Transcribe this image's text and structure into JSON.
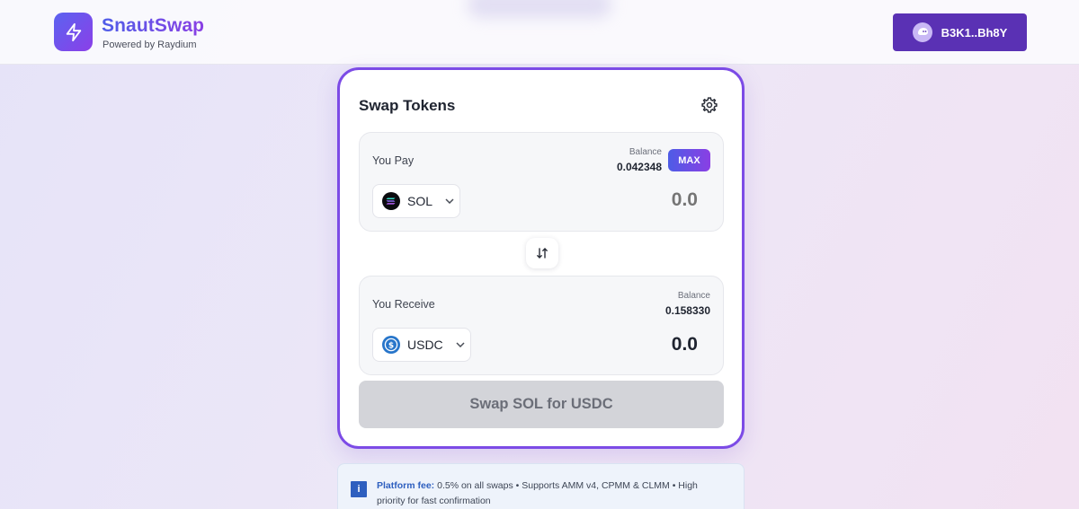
{
  "header": {
    "brand_title": "SnautSwap",
    "brand_subtitle": "Powered by Raydium",
    "wallet_label": "B3K1..Bh8Y"
  },
  "swap": {
    "title": "Swap Tokens",
    "pay": {
      "label": "You Pay",
      "balance_label": "Balance",
      "balance_value": "0.042348",
      "max_label": "MAX",
      "token": "SOL",
      "amount_placeholder": "0.0"
    },
    "receive": {
      "label": "You Receive",
      "balance_label": "Balance",
      "balance_value": "0.158330",
      "token": "USDC",
      "amount": "0.0"
    },
    "action_label": "Swap SOL for USDC"
  },
  "info": {
    "strong": "Platform fee:",
    "text": " 0.5% on all swaps • Supports AMM v4, CPMM & CLMM • High priority for fast confirmation"
  },
  "colors": {
    "accent_start": "#4f5de8",
    "accent_end": "#8a3fe4",
    "wallet_button": "#5a31b4",
    "disabled_button": "#d3d4d9",
    "info_blue": "#2e5fbf"
  },
  "icons": {
    "logo": "lightning-icon",
    "wallet": "phantom-ghost-icon",
    "settings": "gear-icon",
    "switch": "swap-vertical-arrows-icon",
    "sol": "solana-icon",
    "usdc": "usdc-icon",
    "chevron": "chevron-down-icon",
    "info": "info-icon"
  }
}
